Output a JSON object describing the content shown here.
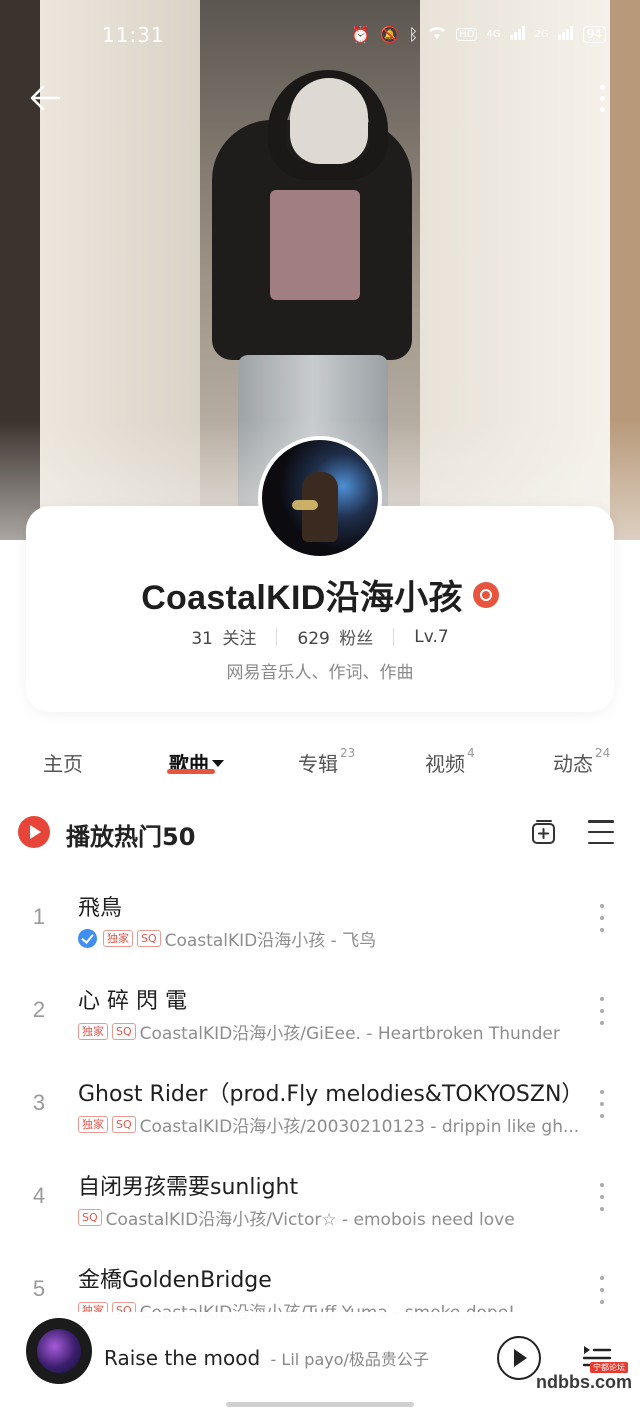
{
  "status_bar": {
    "time": "11:31",
    "network_1": "4G",
    "network_2": "2G",
    "hd_label": "HD",
    "battery": "94"
  },
  "profile": {
    "name": "CoastalKID沿海小孩",
    "following_count": "31",
    "following_label": "关注",
    "followers_count": "629",
    "followers_label": "粉丝",
    "level": "Lv.7",
    "bio": "网易音乐人、作词、作曲"
  },
  "tabs": [
    {
      "label": "主页",
      "count": ""
    },
    {
      "label": "歌曲",
      "count": ""
    },
    {
      "label": "专辑",
      "count": "23"
    },
    {
      "label": "视频",
      "count": "4"
    },
    {
      "label": "动态",
      "count": "24"
    }
  ],
  "active_tab": "歌曲",
  "section": {
    "title": "播放热门50"
  },
  "tags": {
    "exclusive": "独家",
    "sq": "SQ"
  },
  "songs": [
    {
      "index": "1",
      "title": "飛鳥",
      "meta": "CoastalKID沿海小孩 - 飞鸟",
      "verified": true,
      "exclusive": true,
      "sq": true
    },
    {
      "index": "2",
      "title": "心 碎 閃 電",
      "meta": "CoastalKID沿海小孩/GiEee. - Heartbroken Thunder",
      "verified": false,
      "exclusive": true,
      "sq": true
    },
    {
      "index": "3",
      "title": "Ghost Rider（prod.Fly melodies&TOKYOSZN）",
      "meta": "CoastalKID沿海小孩/20030210123 - drippin like gh...",
      "verified": false,
      "exclusive": true,
      "sq": true
    },
    {
      "index": "4",
      "title": "自闭男孩需要sunlight",
      "meta": "CoastalKID沿海小孩/Victor☆ - emobois need love",
      "verified": false,
      "exclusive": false,
      "sq": true
    },
    {
      "index": "5",
      "title": "金橋GoldenBridge",
      "meta": "CoastalKID沿海小孩/Tuff Yuma - smoke dope!",
      "verified": false,
      "exclusive": true,
      "sq": true
    }
  ],
  "player": {
    "track": "Raise the mood",
    "artist": "- Lil payo/极品贵公子"
  },
  "watermark": {
    "text": "ndbbs.com",
    "tag": "宁都论坛"
  },
  "colors": {
    "accent": "#e8553f",
    "play_red": "#e8453a",
    "verified_blue": "#3f8ef0"
  }
}
